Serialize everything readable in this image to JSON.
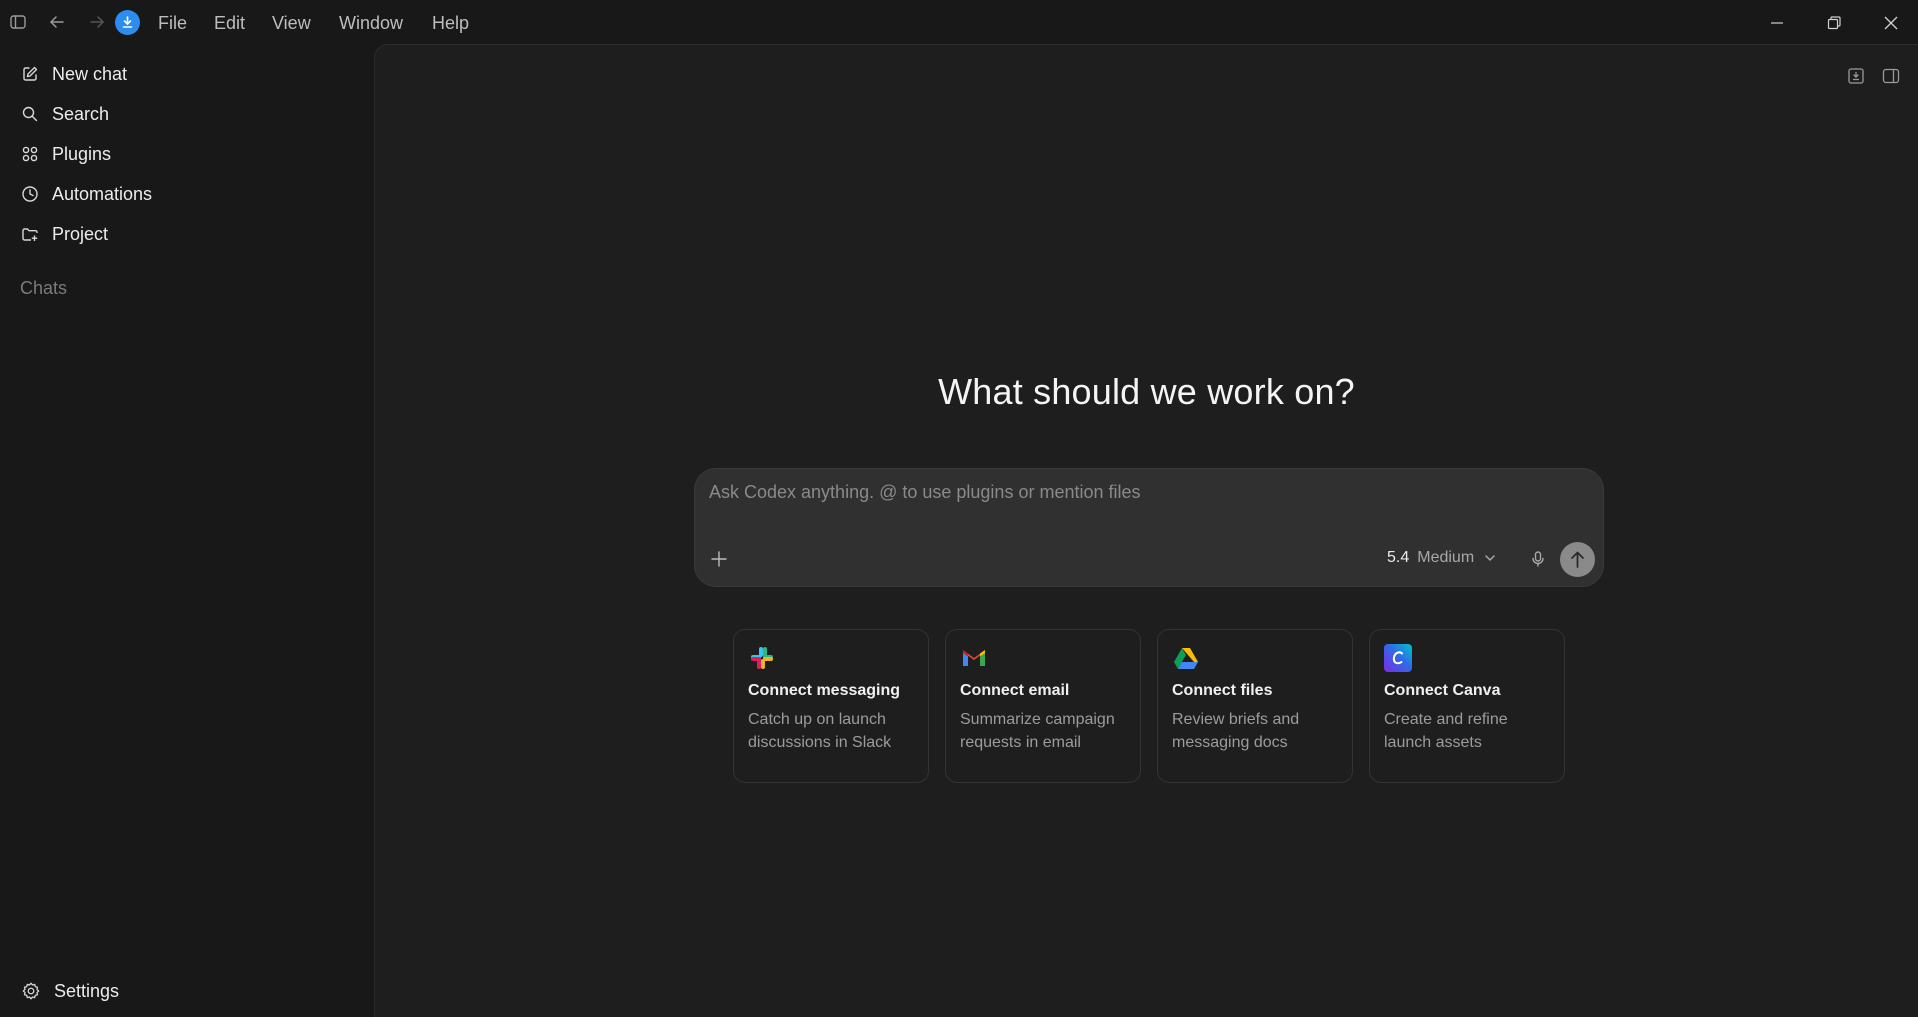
{
  "titlebar": {
    "menus": [
      "File",
      "Edit",
      "View",
      "Window",
      "Help"
    ]
  },
  "sidebar": {
    "items": [
      {
        "label": "New chat",
        "icon": "edit-icon"
      },
      {
        "label": "Search",
        "icon": "search-icon"
      },
      {
        "label": "Plugins",
        "icon": "grid-icon"
      },
      {
        "label": "Automations",
        "icon": "clock-icon"
      },
      {
        "label": "Project",
        "icon": "folder-plus-icon"
      }
    ],
    "chats_label": "Chats",
    "settings_label": "Settings"
  },
  "main": {
    "headline": "What should we work on?",
    "composer": {
      "placeholder": "Ask Codex anything. @ to use plugins or mention files",
      "model_version": "5.4",
      "effort": "Medium"
    },
    "cards": [
      {
        "title": "Connect messaging",
        "description": "Catch up on launch discussions in Slack",
        "icon": "slack-icon"
      },
      {
        "title": "Connect email",
        "description": "Summarize campaign requests in email",
        "icon": "gmail-icon"
      },
      {
        "title": "Connect files",
        "description": "Review briefs and messaging docs",
        "icon": "google-drive-icon"
      },
      {
        "title": "Connect Canva",
        "description": "Create and refine launch assets",
        "icon": "canva-icon"
      }
    ]
  },
  "colors": {
    "background": "#181818",
    "panel": "#1e1e1e",
    "composer": "#303030",
    "accent": "#2d8cf0"
  }
}
